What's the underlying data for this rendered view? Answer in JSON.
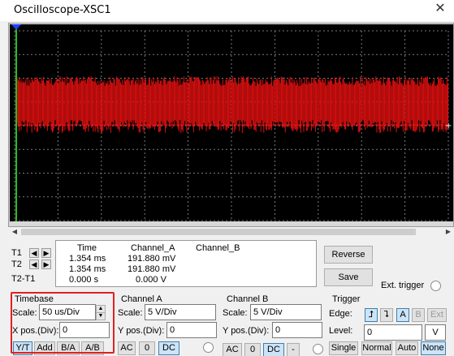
{
  "window": {
    "title": "Oscilloscope-XSC1",
    "close_icon": "close-icon"
  },
  "colors": {
    "trace": "#e01010",
    "grid": "#7a7a7a",
    "screen": "#000000",
    "cursor1": "#22c022",
    "cursor2": "#2040ff",
    "highlight": "#e02020"
  },
  "cursors": [
    {
      "label": "T1",
      "left_icon": "arrow-left-icon",
      "right_icon": "arrow-right-icon"
    },
    {
      "label": "T2",
      "left_icon": "arrow-left-icon",
      "right_icon": "arrow-right-icon"
    },
    {
      "label": "T2-T1"
    }
  ],
  "readout": {
    "headers": [
      "Time",
      "Channel_A",
      "Channel_B"
    ],
    "rows": [
      {
        "time": "1.354 ms",
        "channel_a": "191.880 mV",
        "channel_b": ""
      },
      {
        "time": "1.354 ms",
        "channel_a": "191.880 mV",
        "channel_b": ""
      },
      {
        "time": "0.000 s",
        "channel_a": "0.000 V",
        "channel_b": ""
      }
    ]
  },
  "buttons": {
    "reverse": "Reverse",
    "save": "Save"
  },
  "ext_trigger": {
    "label": "Ext. trigger"
  },
  "timebase": {
    "title": "Timebase",
    "scale_label": "Scale:",
    "scale_value": "50 us/Div",
    "xpos_label": "X pos.(Div):",
    "xpos_value": "0",
    "modes": [
      "Y/T",
      "Add",
      "B/A",
      "A/B"
    ],
    "selected_mode": "Y/T"
  },
  "channel_a": {
    "title": "Channel A",
    "scale_label": "Scale:",
    "scale_value": "5  V/Div",
    "ypos_label": "Y pos.(Div):",
    "ypos_value": "0",
    "coupling": [
      "AC",
      "0",
      "DC"
    ],
    "selected_coupling": "DC"
  },
  "channel_b": {
    "title": "Channel B",
    "scale_label": "Scale:",
    "scale_value": "5  V/Div",
    "ypos_label": "Y pos.(Div):",
    "ypos_value": "0",
    "coupling": [
      "AC",
      "0",
      "DC",
      "-"
    ],
    "selected_coupling": "DC"
  },
  "trigger": {
    "title": "Trigger",
    "edge_label": "Edge:",
    "edge_options": [
      "A",
      "B",
      "Ext"
    ],
    "selected_edge": "A",
    "level_label": "Level:",
    "level_value": "0",
    "level_unit": "V",
    "modes": [
      "Single",
      "Normal",
      "Auto",
      "None"
    ],
    "selected_mode": "None"
  }
}
